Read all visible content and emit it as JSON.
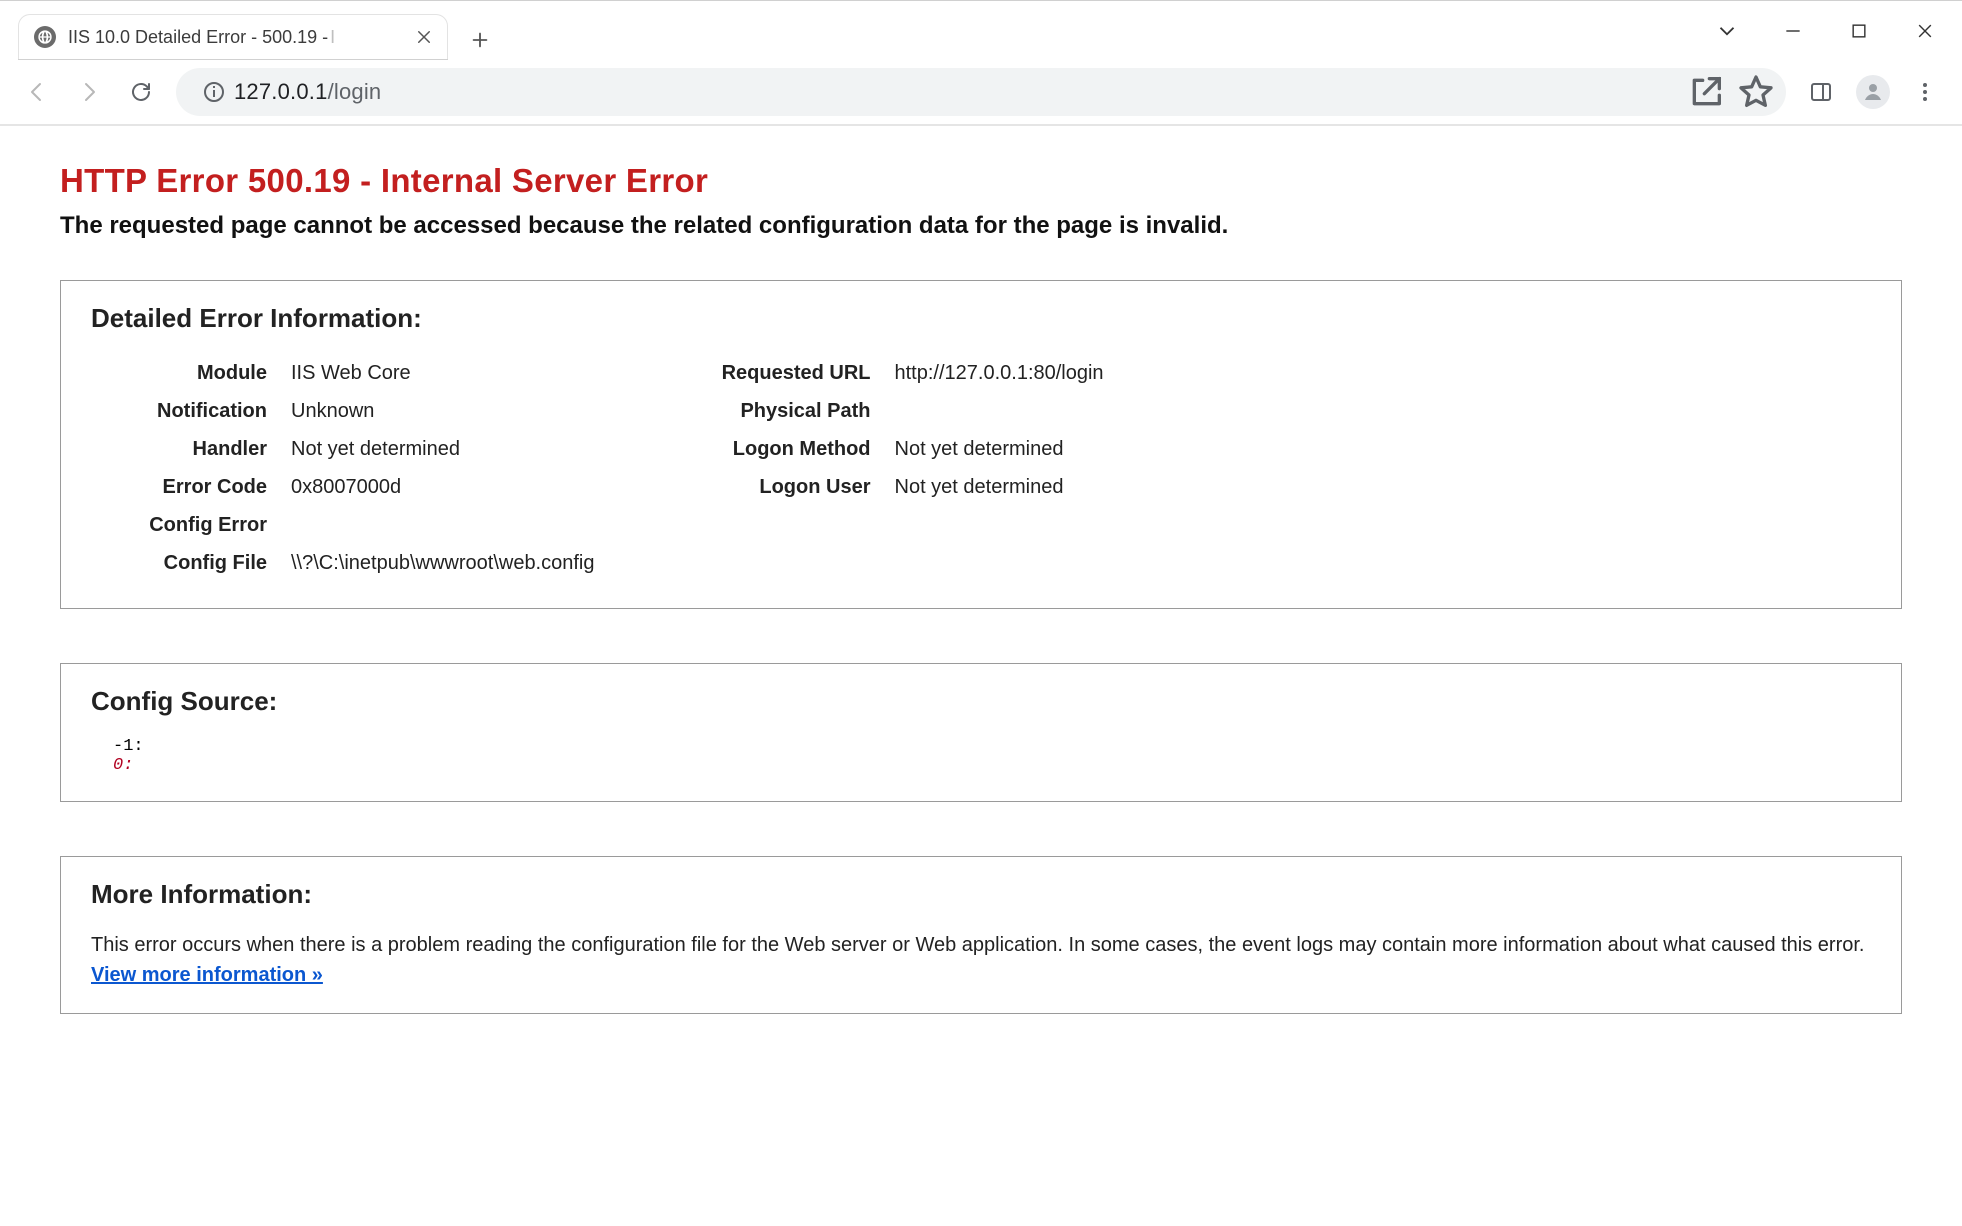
{
  "window": {
    "tab_title": "IIS 10.0 Detailed Error - 500.19 -",
    "tab_title_trail": "I"
  },
  "toolbar": {
    "url_host": "127.0.0.1",
    "url_path": "/login"
  },
  "page": {
    "heading": "HTTP Error 500.19 - Internal Server Error",
    "subheading": "The requested page cannot be accessed because the related configuration data for the page is invalid.",
    "detail_title": "Detailed Error Information:",
    "details_left": [
      {
        "label": "Module",
        "value": "IIS Web Core"
      },
      {
        "label": "Notification",
        "value": "Unknown"
      },
      {
        "label": "Handler",
        "value": "Not yet determined"
      },
      {
        "label": "Error Code",
        "value": "0x8007000d"
      },
      {
        "label": "Config Error",
        "value": ""
      },
      {
        "label": "Config File",
        "value": "\\\\?\\C:\\inetpub\\wwwroot\\web.config"
      }
    ],
    "details_right": [
      {
        "label": "Requested URL",
        "value": "http://127.0.0.1:80/login"
      },
      {
        "label": "Physical Path",
        "value": ""
      },
      {
        "label": "Logon Method",
        "value": "Not yet determined"
      },
      {
        "label": "Logon User",
        "value": "Not yet determined"
      }
    ],
    "config_source_title": "Config Source:",
    "config_source": {
      "line_neg": "-1:",
      "line_zero": "0:"
    },
    "more_info_title": "More Information:",
    "more_info_text": "This error occurs when there is a problem reading the configuration file for the Web server or Web application. In some cases, the event logs may contain more information about what caused this error.",
    "view_more_label": "View more information »"
  }
}
